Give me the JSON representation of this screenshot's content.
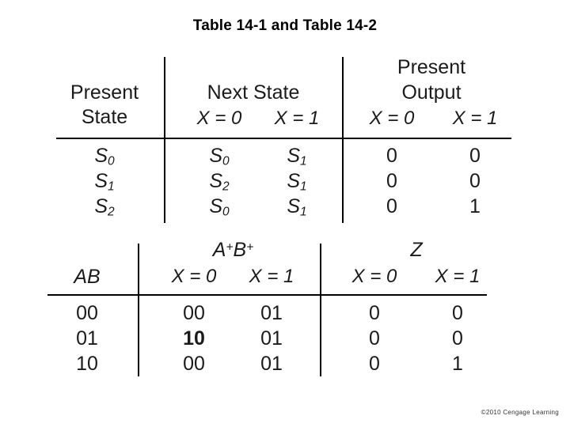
{
  "slide": {
    "title": "Table 14-1 and Table 14-2",
    "copyright": "©2010 Cengage Learning",
    "background_color": "#ffffff",
    "text_color": "#1b1b1b",
    "rule_color": "#000000"
  },
  "table1": {
    "caption": "Table 14-1",
    "col_groups": [
      {
        "label_line1": "Present",
        "label_line2": "State"
      },
      {
        "label_line1": "Next State"
      },
      {
        "label_line1": "Present",
        "label_line2": "Output"
      }
    ],
    "headers": {
      "present_state_line1": "Present",
      "present_state_line2": "State",
      "next_state": "Next State",
      "present_output_line1": "Present",
      "present_output_line2": "Output",
      "x_eq_0": "X = 0",
      "x_eq_1": "X = 1"
    },
    "rows": [
      {
        "present_state": "S",
        "present_state_sub": "0",
        "next_x0": "S",
        "next_x0_sub": "0",
        "next_x1": "S",
        "next_x1_sub": "1",
        "out_x0": "0",
        "out_x1": "0"
      },
      {
        "present_state": "S",
        "present_state_sub": "1",
        "next_x0": "S",
        "next_x0_sub": "2",
        "next_x1": "S",
        "next_x1_sub": "1",
        "out_x0": "0",
        "out_x1": "0"
      },
      {
        "present_state": "S",
        "present_state_sub": "2",
        "next_x0": "S",
        "next_x0_sub": "0",
        "next_x1": "S",
        "next_x1_sub": "1",
        "out_x0": "0",
        "out_x1": "1"
      }
    ]
  },
  "table2": {
    "caption": "Table 14-2",
    "headers": {
      "ab": "AB",
      "ab_next_base_a": "A",
      "ab_next_sup_a": "+",
      "ab_next_base_b": "B",
      "ab_next_sup_b": "+",
      "z": "Z",
      "x_eq_0": "X = 0",
      "x_eq_1": "X = 1"
    },
    "rows": [
      {
        "ab": "00",
        "ab_next_x0": "00",
        "ab_next_x1": "01",
        "z_x0": "0",
        "z_x1": "0"
      },
      {
        "ab": "01",
        "ab_next_x0": "10",
        "ab_next_x1": "01",
        "z_x0": "0",
        "z_x1": "0"
      },
      {
        "ab": "10",
        "ab_next_x0": "00",
        "ab_next_x1": "01",
        "z_x0": "0",
        "z_x1": "1"
      }
    ]
  }
}
